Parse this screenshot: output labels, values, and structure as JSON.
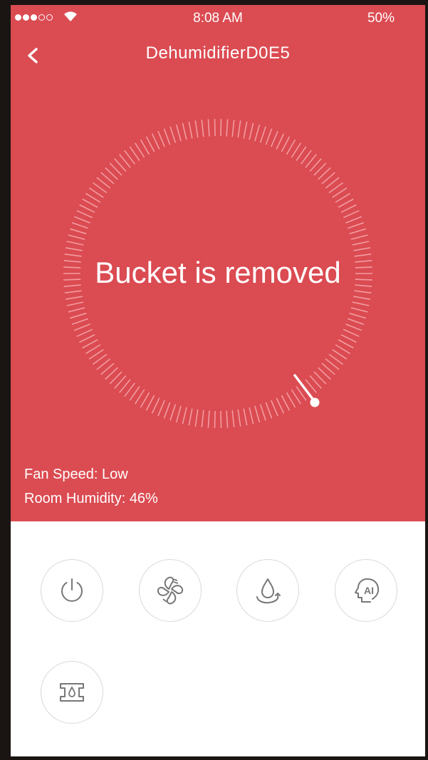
{
  "status_bar": {
    "signal_dots_filled": 3,
    "signal_dots_total": 5,
    "time": "8:08 AM",
    "battery": "50%"
  },
  "header": {
    "title": "DehumidifierD0E5",
    "back_icon": "chevron-left-icon"
  },
  "dial": {
    "message": "Bucket is removed"
  },
  "info": {
    "fan_speed": "Fan Speed: Low",
    "room_humidity": "Room Humidity: 46%"
  },
  "controls": [
    {
      "name": "power",
      "icon": "power-icon"
    },
    {
      "name": "fan",
      "icon": "fan-icon"
    },
    {
      "name": "dehumidify",
      "icon": "water-drop-icon"
    },
    {
      "name": "ai",
      "icon": "ai-head-icon",
      "label": "AI"
    },
    {
      "name": "bucket",
      "icon": "bucket-icon"
    }
  ],
  "colors": {
    "accent": "#db4b52",
    "background": "#ffffff",
    "button_border": "#d9d9d9",
    "icon": "#777777"
  }
}
